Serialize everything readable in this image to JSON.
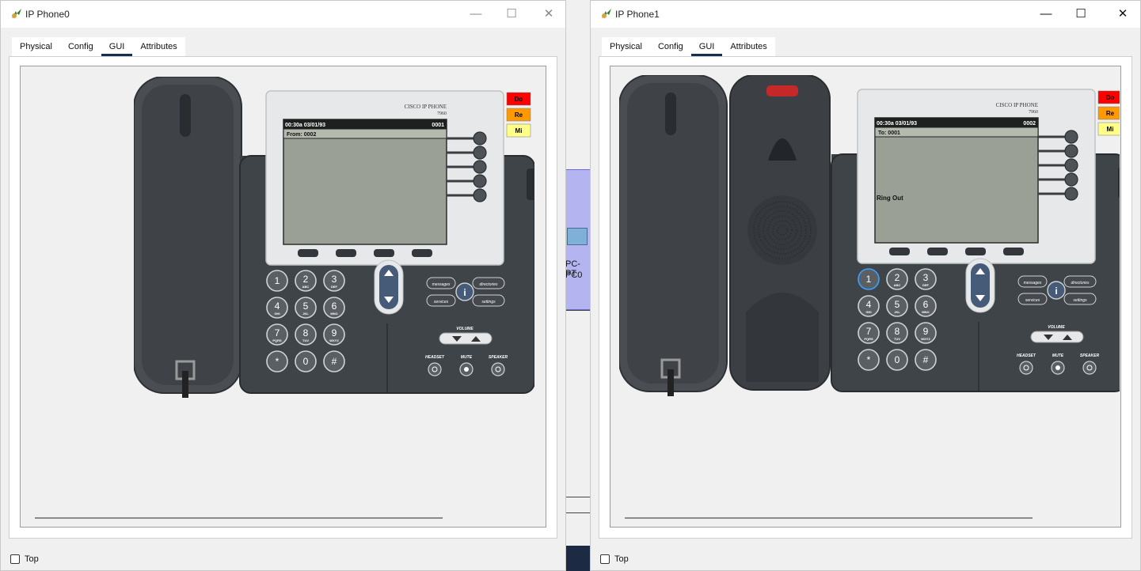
{
  "background": {
    "pc_type": "PC-PT",
    "pc_name": "PC0"
  },
  "windows": [
    {
      "title": "IP Phone0",
      "controls": {
        "minimize": "—",
        "maximize": "☐",
        "close": "✕"
      },
      "tabs": [
        {
          "label": "Physical"
        },
        {
          "label": "Config"
        },
        {
          "label": "GUI"
        },
        {
          "label": "Attributes"
        }
      ],
      "active_tab": "GUI",
      "phone": {
        "brand": "CISCO IP PHONE",
        "model": "7960",
        "status_time": "00:30a 03/01/93",
        "extension": "0001",
        "line1": "From: 0002",
        "message": "",
        "indicators": [
          {
            "label": "Do",
            "color": "#ff0000"
          },
          {
            "label": "Re",
            "color": "#ff9900"
          },
          {
            "label": "Mi",
            "color": "#ffff88"
          }
        ],
        "handset_state": "on-hook"
      },
      "top_checkbox": "Top"
    },
    {
      "title": "IP Phone1",
      "controls": {
        "minimize": "—",
        "maximize": "☐",
        "close": "✕"
      },
      "tabs": [
        {
          "label": "Physical"
        },
        {
          "label": "Config"
        },
        {
          "label": "GUI"
        },
        {
          "label": "Attributes"
        }
      ],
      "active_tab": "GUI",
      "phone": {
        "brand": "CISCO IP PHONE",
        "model": "7960",
        "status_time": "00:30a 03/01/93",
        "extension": "0002",
        "line1": "To: 0001",
        "message": "Ring Out",
        "indicators": [
          {
            "label": "Do",
            "color": "#ff0000"
          },
          {
            "label": "Re",
            "color": "#ff9900"
          },
          {
            "label": "Mi",
            "color": "#ffff88"
          }
        ],
        "handset_state": "off-hook"
      },
      "top_checkbox": "Top"
    }
  ],
  "keypad": {
    "keys": [
      {
        "num": "1",
        "sub": ""
      },
      {
        "num": "2",
        "sub": "ABC"
      },
      {
        "num": "3",
        "sub": "DEF"
      },
      {
        "num": "4",
        "sub": "GHI"
      },
      {
        "num": "5",
        "sub": "JKL"
      },
      {
        "num": "6",
        "sub": "MNO"
      },
      {
        "num": "7",
        "sub": "PQRS"
      },
      {
        "num": "8",
        "sub": "TUV"
      },
      {
        "num": "9",
        "sub": "WXYZ"
      },
      {
        "num": "*",
        "sub": ""
      },
      {
        "num": "0",
        "sub": ""
      },
      {
        "num": "#",
        "sub": ""
      }
    ],
    "messages": "messages",
    "directories": "directories",
    "services": "services",
    "settings": "settings",
    "info": "i",
    "volume": "VOLUME",
    "headset": "HEADSET",
    "mute": "MUTE",
    "speaker": "SPEAKER"
  }
}
